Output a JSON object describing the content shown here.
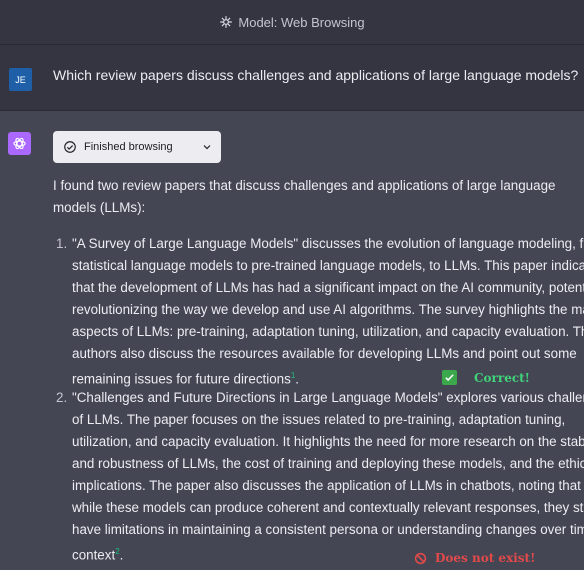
{
  "header": {
    "title": "Model: Web Browsing",
    "icon": "openai-logo-icon"
  },
  "user_message": {
    "avatar": "JE",
    "text": "Which review papers discuss challenges and applications of large language models?"
  },
  "assistant": {
    "browsing_status": "Finished browsing",
    "intro_lines": [
      "I found two review papers that discuss challenges and applications of large language",
      "models (LLMs):"
    ],
    "items": [
      {
        "number": "1.",
        "lines": [
          "\"A Survey of Large Language Models\" discusses the evolution of language modeling, from",
          "statistical language models to pre-trained language models, to LLMs. This paper indicates",
          "that the development of LLMs has had a significant impact on the AI community, potentially",
          "revolutionizing the way we develop and use AI algorithms. The survey highlights the main",
          "aspects of LLMs: pre-training, adaptation tuning, utilization, and capacity evaluation. The",
          "authors also discuss the resources available for developing LLMs and point out some",
          "remaining issues for future directions"
        ],
        "citation": "1",
        "end_punct": ".",
        "verdict": "Correct!"
      },
      {
        "number": "2.",
        "lines": [
          "\"Challenges and Future Directions in Large Language Models\" explores various challenges",
          "of LLMs. The paper focuses on the issues related to pre-training, adaptation tuning,",
          "utilization, and capacity evaluation. It highlights the need for more research on the stability",
          "and robustness of LLMs, the cost of training and deploying these models, and the ethical",
          "implications. The paper also discusses the application of LLMs in chatbots, noting that",
          "while these models can produce coherent and contextually relevant responses, they still",
          "have limitations in maintaining a consistent persona or understanding changes over time in",
          "context"
        ],
        "citation": "2",
        "end_punct": ".",
        "verdict": "Does not exist!"
      }
    ]
  },
  "colors": {
    "background": "#444654",
    "header_bg": "#343541",
    "user_avatar": "#1e5fa8",
    "assistant_avatar": "#ab68ff",
    "correct": "#3fd47a",
    "wrong": "#e24a4a",
    "citation": "#19c37d"
  }
}
